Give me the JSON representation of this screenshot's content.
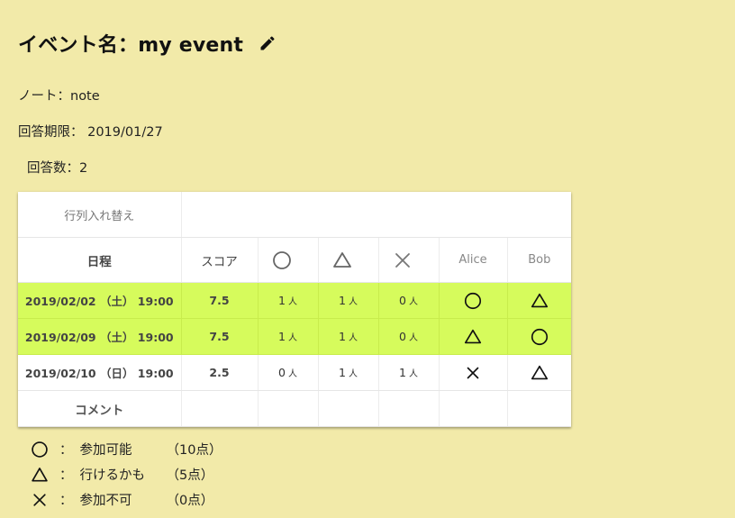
{
  "event": {
    "title_prefix": "イベント名：",
    "title_name": "my event",
    "note_label": "ノート：",
    "note_value": "note",
    "deadline_label": "回答期限：",
    "deadline_value": "2019/01/27",
    "answers_label": "回答数：",
    "answers_value": "2"
  },
  "table": {
    "swap_label": "行列入れ替え",
    "headers": {
      "date": "日程",
      "score": "スコア",
      "ok_icon": "circle-icon",
      "maybe_icon": "triangle-icon",
      "ng_icon": "cross-icon",
      "participants": [
        "Alice",
        "Bob"
      ]
    },
    "unit": "人",
    "rows": [
      {
        "date": "2019/02/02 （土） 19:00",
        "score": "7.5",
        "ok": "1",
        "maybe": "1",
        "ng": "0",
        "answers": [
          "circle",
          "triangle"
        ],
        "highlight": true
      },
      {
        "date": "2019/02/09 （土） 19:00",
        "score": "7.5",
        "ok": "1",
        "maybe": "1",
        "ng": "0",
        "answers": [
          "triangle",
          "circle"
        ],
        "highlight": true
      },
      {
        "date": "2019/02/10 （日） 19:00",
        "score": "2.5",
        "ok": "0",
        "maybe": "1",
        "ng": "1",
        "answers": [
          "cross",
          "triangle"
        ],
        "highlight": false
      }
    ],
    "comment_label": "コメント"
  },
  "legend": [
    {
      "icon": "circle",
      "colon": "：",
      "label": "参加可能",
      "points": "（10点）"
    },
    {
      "icon": "triangle",
      "colon": "：",
      "label": "行けるかも",
      "points": "（5点）"
    },
    {
      "icon": "cross",
      "colon": "：",
      "label": "参加不可",
      "points": "（0点）"
    }
  ],
  "colors": {
    "background": "#f2eaa9",
    "highlight_row": "#d6fb5c",
    "card": "#ffffff"
  }
}
